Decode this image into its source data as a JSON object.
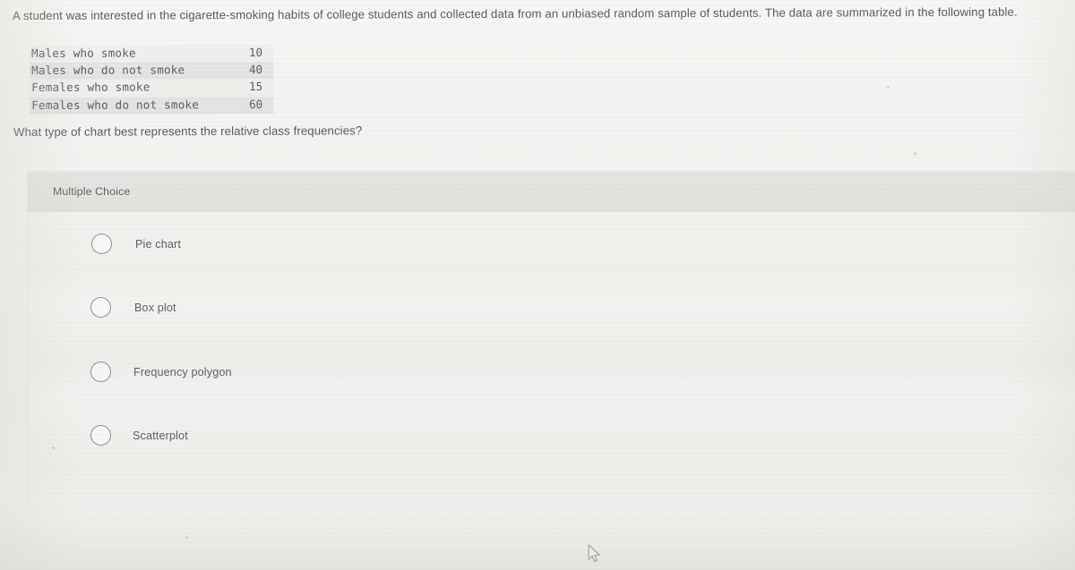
{
  "stem": {
    "text": "A student was interested in the cigarette-smoking habits of college students and collected data from an unbiased random sample of students. The data are summarized in the following table."
  },
  "table": {
    "rows": [
      {
        "label": "Males who smoke",
        "value": "10"
      },
      {
        "label": "Males who do not smoke",
        "value": "40"
      },
      {
        "label": "Females who smoke",
        "value": "15"
      },
      {
        "label": "Females who do not smoke",
        "value": "60"
      }
    ]
  },
  "question": {
    "text": "What type of chart best represents the relative class frequencies?"
  },
  "card": {
    "header_label": "Multiple Choice",
    "options": [
      {
        "label": "Pie chart"
      },
      {
        "label": "Box plot"
      },
      {
        "label": "Frequency polygon"
      },
      {
        "label": "Scatterplot"
      }
    ]
  },
  "cursor": {
    "icon": "mouse-pointer-icon"
  },
  "colors": {
    "page_background": "#f1f2ef",
    "card_background": "#eff0ec",
    "card_header": "#e3e5e1",
    "text": "#57595a",
    "radio_border": "#8e9193"
  }
}
